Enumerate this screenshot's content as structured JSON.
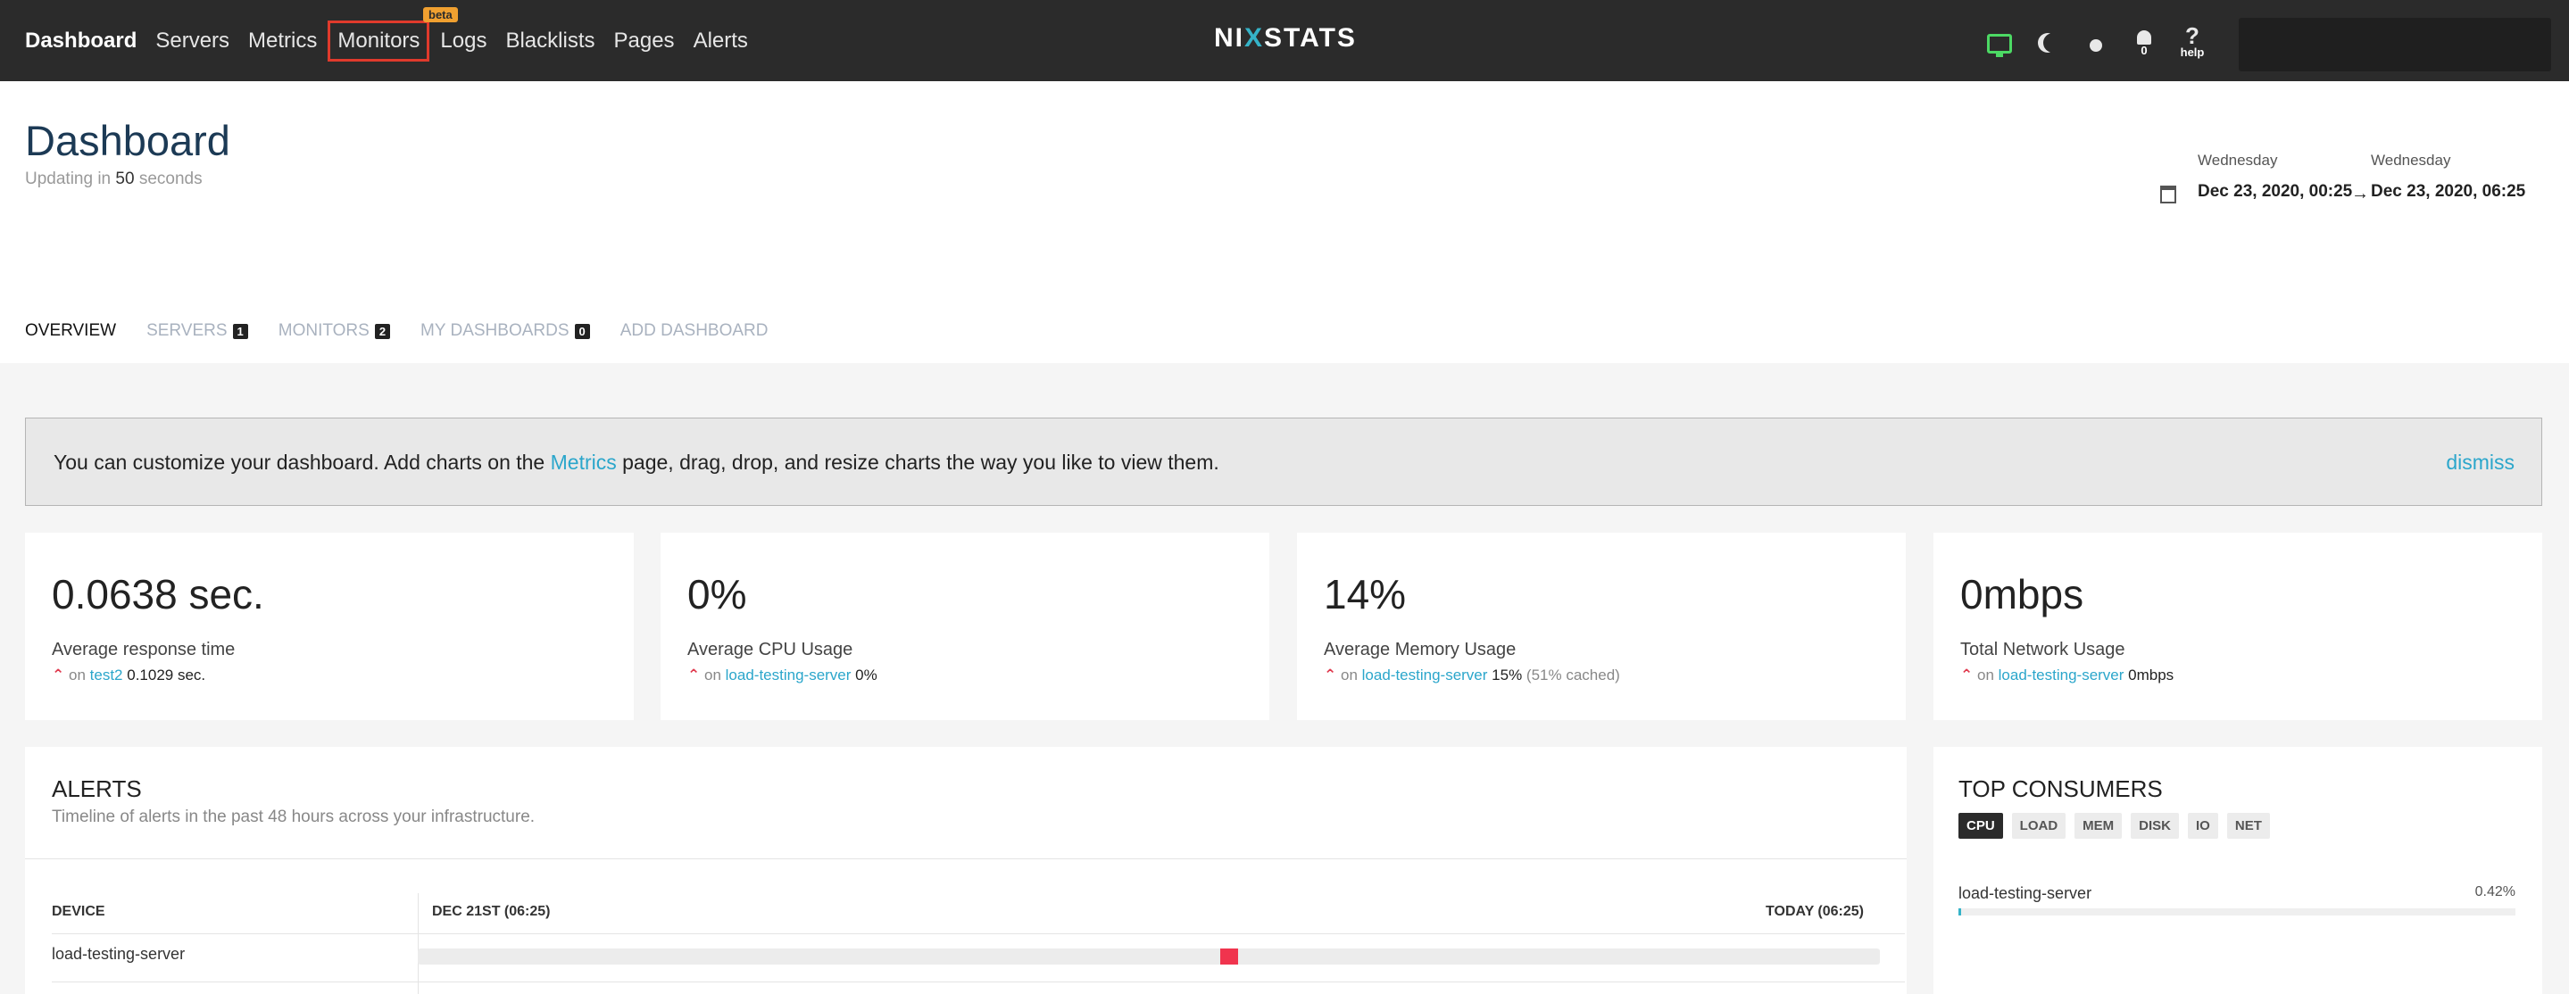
{
  "nav": {
    "items": [
      "Dashboard",
      "Servers",
      "Metrics",
      "Monitors",
      "Logs",
      "Blacklists",
      "Pages",
      "Alerts"
    ],
    "beta_badge": "beta",
    "logo_left": "NI",
    "logo_x": "X",
    "logo_right": "STATS",
    "notifications_count": "0",
    "help_label": "help",
    "accent_color": "#4cd964"
  },
  "header": {
    "title": "Dashboard",
    "updating_prefix": "Updating in",
    "updating_seconds": "50",
    "updating_suffix": "seconds",
    "from_day": "Wednesday",
    "from_date": "Dec 23, 2020, 00:25",
    "to_day": "Wednesday",
    "to_date": "Dec 23, 2020, 06:25"
  },
  "tabs": [
    {
      "label": "OVERVIEW",
      "count": ""
    },
    {
      "label": "SERVERS",
      "count": "1"
    },
    {
      "label": "MONITORS",
      "count": "2"
    },
    {
      "label": "MY DASHBOARDS",
      "count": "0"
    },
    {
      "label": "ADD DASHBOARD",
      "count": ""
    }
  ],
  "banner": {
    "text_before": "You can customize your dashboard. Add charts on the",
    "link": "Metrics",
    "text_after": "page, drag, drop, and resize charts the way you like to view them.",
    "dismiss": "dismiss"
  },
  "stats": [
    {
      "value": "0.0638 sec.",
      "label": "Average response time",
      "on": "on",
      "target": "test2",
      "detail": "0.1029 sec.",
      "extra": ""
    },
    {
      "value": "0%",
      "label": "Average CPU Usage",
      "on": "on",
      "target": "load-testing-server",
      "detail": "0%",
      "extra": ""
    },
    {
      "value": "14%",
      "label": "Average Memory Usage",
      "on": "on",
      "target": "load-testing-server",
      "detail": "15%",
      "extra": "(51% cached)"
    },
    {
      "value": "0mbps",
      "label": "Total Network Usage",
      "on": "on",
      "target": "load-testing-server",
      "detail": "0mbps",
      "extra": ""
    }
  ],
  "alerts": {
    "title": "ALERTS",
    "subtitle": "Timeline of alerts in the past 48 hours across your infrastructure.",
    "col_device": "DEVICE",
    "col_start": "DEC 21ST (06:25)",
    "col_end": "TODAY (06:25)",
    "rows": [
      {
        "device": "load-testing-server",
        "alert_position": 0.555
      }
    ],
    "alert_color": "#f0344e"
  },
  "consumers": {
    "title": "TOP CONSUMERS",
    "tabs": [
      "CPU",
      "LOAD",
      "MEM",
      "DISK",
      "IO",
      "NET"
    ],
    "active_tab": "CPU",
    "items": [
      {
        "name": "load-testing-server",
        "value": "0.42%",
        "fraction": 0.0042
      }
    ]
  }
}
